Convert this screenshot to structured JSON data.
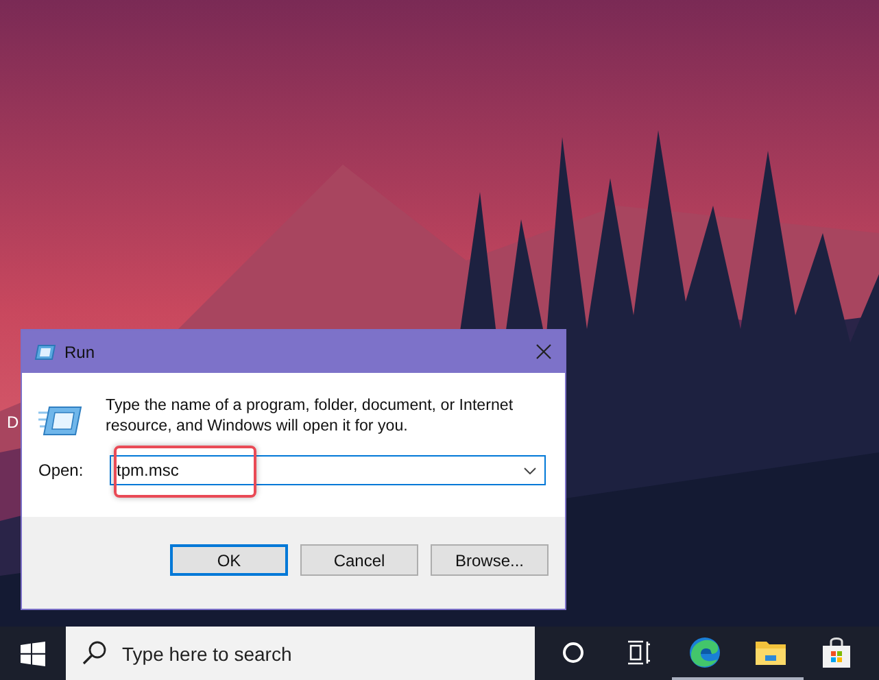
{
  "desktop": {
    "icon_label": "D"
  },
  "dialog": {
    "title": "Run",
    "message": "Type the name of a program, folder, document, or Internet resource, and Windows will open it for you.",
    "open_label": "Open:",
    "open_value": "tpm.msc",
    "buttons": [
      {
        "label": "OK",
        "default": true
      },
      {
        "label": "Cancel",
        "default": false
      },
      {
        "label": "Browse...",
        "default": false
      }
    ]
  },
  "taskbar": {
    "search_placeholder": "Type here to search",
    "apps": [
      {
        "kind": "cortana",
        "running": false
      },
      {
        "kind": "taskview",
        "running": false
      },
      {
        "kind": "edge",
        "running": true
      },
      {
        "kind": "explorer",
        "running": true
      },
      {
        "kind": "store",
        "running": false
      }
    ]
  }
}
